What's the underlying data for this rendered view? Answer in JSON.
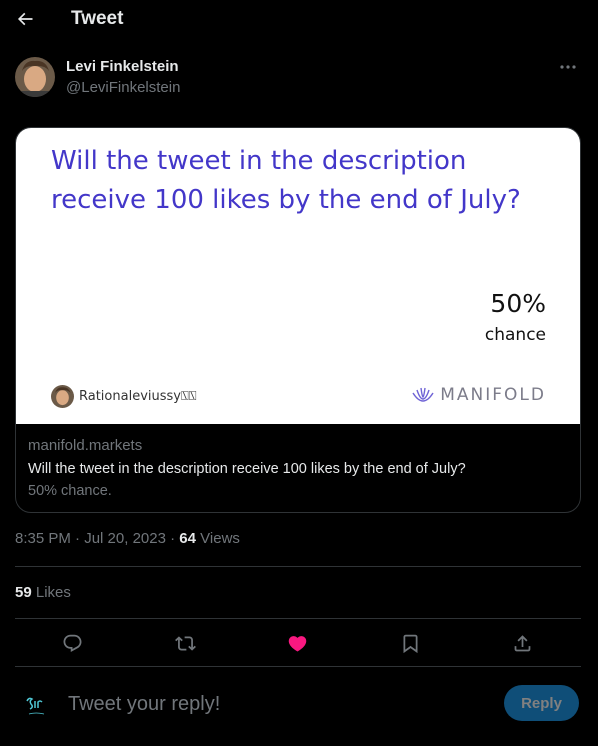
{
  "header": {
    "title": "Tweet",
    "back_icon": "arrow-left-icon"
  },
  "author": {
    "name": "Levi Finkelstein",
    "handle": "@LeviFinkelstein",
    "more_icon": "more-dots-icon"
  },
  "card": {
    "question": "Will the tweet in the description receive 100 likes by the end of July?",
    "probability": "50%",
    "probability_label": "chance",
    "creator": "Rationaleviussy⍂⍂",
    "brand": "MANIFOLD",
    "domain": "manifold.markets",
    "title": "Will the tweet in the description receive 100 likes by the end of July?",
    "description": "50% chance.",
    "accent_color": "#4337c9"
  },
  "meta": {
    "time": "8:35 PM",
    "separator": "·",
    "date": "Jul 20, 2023",
    "views_count": "64",
    "views_label": "Views"
  },
  "likes": {
    "count": "59",
    "label": "Likes"
  },
  "actions": {
    "reply_icon": "reply-bubble-icon",
    "retweet_icon": "retweet-icon",
    "like_icon": "heart-filled-icon",
    "bookmark_icon": "bookmark-icon",
    "share_icon": "share-icon",
    "like_color": "#f91880"
  },
  "reply": {
    "placeholder": "Tweet your reply!",
    "button_label": "Reply"
  }
}
